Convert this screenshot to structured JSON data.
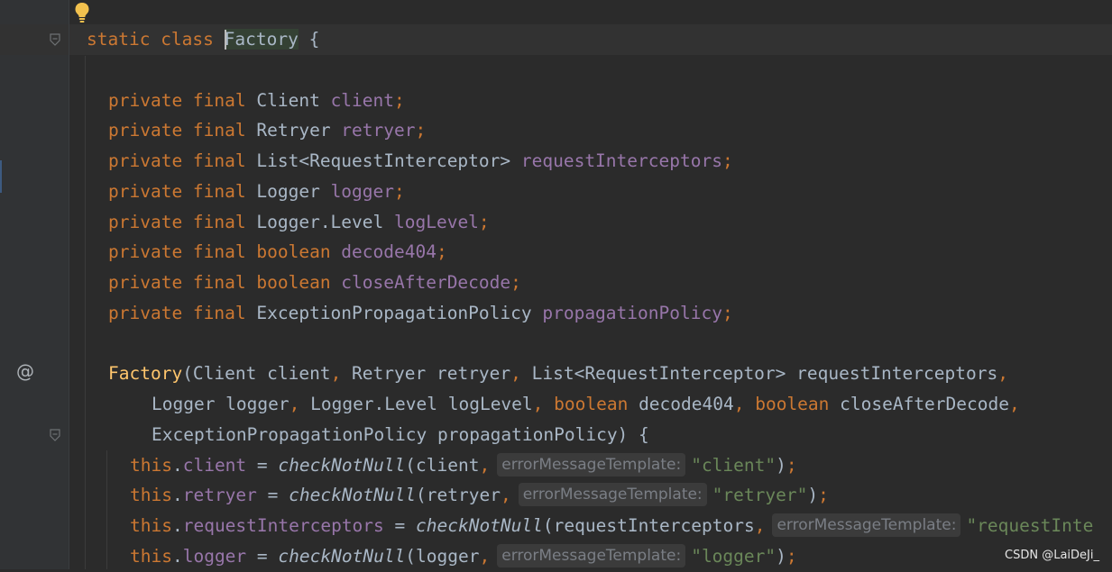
{
  "gutter": {
    "annotation_marker": "@"
  },
  "code_lines": [
    {
      "id": "class-decl",
      "tokens": [
        {
          "t": "static ",
          "c": "kw"
        },
        {
          "t": "class ",
          "c": "kw"
        },
        {
          "t": "Factory",
          "c": "plain",
          "cursor": true,
          "highlight": true
        },
        {
          "t": " {",
          "c": "plain"
        }
      ]
    },
    {
      "id": "blank-1",
      "tokens": []
    },
    {
      "id": "field-client",
      "tokens": [
        {
          "t": "private ",
          "c": "kw"
        },
        {
          "t": "final ",
          "c": "kw"
        },
        {
          "t": "Client ",
          "c": "plain"
        },
        {
          "t": "client",
          "c": "fld"
        },
        {
          "t": ";",
          "c": "kw"
        }
      ]
    },
    {
      "id": "field-retryer",
      "tokens": [
        {
          "t": "private ",
          "c": "kw"
        },
        {
          "t": "final ",
          "c": "kw"
        },
        {
          "t": "Retryer ",
          "c": "plain"
        },
        {
          "t": "retryer",
          "c": "fld"
        },
        {
          "t": ";",
          "c": "kw"
        }
      ]
    },
    {
      "id": "field-interceptors",
      "tokens": [
        {
          "t": "private ",
          "c": "kw"
        },
        {
          "t": "final ",
          "c": "kw"
        },
        {
          "t": "List<RequestInterceptor> ",
          "c": "plain"
        },
        {
          "t": "requestInterceptors",
          "c": "fld"
        },
        {
          "t": ";",
          "c": "kw"
        }
      ]
    },
    {
      "id": "field-logger",
      "tokens": [
        {
          "t": "private ",
          "c": "kw"
        },
        {
          "t": "final ",
          "c": "kw"
        },
        {
          "t": "Logger ",
          "c": "plain"
        },
        {
          "t": "logger",
          "c": "fld"
        },
        {
          "t": ";",
          "c": "kw"
        }
      ]
    },
    {
      "id": "field-loglevel",
      "tokens": [
        {
          "t": "private ",
          "c": "kw"
        },
        {
          "t": "final ",
          "c": "kw"
        },
        {
          "t": "Logger.Level ",
          "c": "plain"
        },
        {
          "t": "logLevel",
          "c": "fld"
        },
        {
          "t": ";",
          "c": "kw"
        }
      ]
    },
    {
      "id": "field-decode404",
      "tokens": [
        {
          "t": "private ",
          "c": "kw"
        },
        {
          "t": "final ",
          "c": "kw"
        },
        {
          "t": "boolean ",
          "c": "kw"
        },
        {
          "t": "decode404",
          "c": "fld"
        },
        {
          "t": ";",
          "c": "kw"
        }
      ]
    },
    {
      "id": "field-closeafterdecode",
      "tokens": [
        {
          "t": "private ",
          "c": "kw"
        },
        {
          "t": "final ",
          "c": "kw"
        },
        {
          "t": "boolean ",
          "c": "kw"
        },
        {
          "t": "closeAfterDecode",
          "c": "fld"
        },
        {
          "t": ";",
          "c": "kw"
        }
      ]
    },
    {
      "id": "field-propagationpolicy",
      "tokens": [
        {
          "t": "private ",
          "c": "kw"
        },
        {
          "t": "final ",
          "c": "kw"
        },
        {
          "t": "ExceptionPropagationPolicy ",
          "c": "plain"
        },
        {
          "t": "propagationPolicy",
          "c": "fld"
        },
        {
          "t": ";",
          "c": "kw"
        }
      ]
    },
    {
      "id": "blank-2",
      "tokens": []
    },
    {
      "id": "ctor-sig-1",
      "tokens": [
        {
          "t": "Factory",
          "c": "fn"
        },
        {
          "t": "(Client client",
          "c": "plain"
        },
        {
          "t": ", ",
          "c": "kw"
        },
        {
          "t": "Retryer retryer",
          "c": "plain"
        },
        {
          "t": ", ",
          "c": "kw"
        },
        {
          "t": "List<RequestInterceptor> requestInterceptors",
          "c": "plain"
        },
        {
          "t": ",",
          "c": "kw"
        }
      ]
    },
    {
      "id": "ctor-sig-2",
      "tokens": [
        {
          "t": "Logger logger",
          "c": "plain"
        },
        {
          "t": ", ",
          "c": "kw"
        },
        {
          "t": "Logger.Level logLevel",
          "c": "plain"
        },
        {
          "t": ", ",
          "c": "kw"
        },
        {
          "t": "boolean ",
          "c": "kw"
        },
        {
          "t": "decode404",
          "c": "plain"
        },
        {
          "t": ", ",
          "c": "kw"
        },
        {
          "t": "boolean ",
          "c": "kw"
        },
        {
          "t": "closeAfterDecode",
          "c": "plain"
        },
        {
          "t": ",",
          "c": "kw"
        }
      ]
    },
    {
      "id": "ctor-sig-3",
      "tokens": [
        {
          "t": "ExceptionPropagationPolicy propagationPolicy) {",
          "c": "plain"
        }
      ]
    },
    {
      "id": "assign-client",
      "tokens": [
        {
          "t": "this",
          "c": "kw"
        },
        {
          "t": ".",
          "c": "plain"
        },
        {
          "t": "client",
          "c": "fld"
        },
        {
          "t": " = ",
          "c": "plain"
        },
        {
          "t": "checkNotNull",
          "c": "plain",
          "italic": true
        },
        {
          "t": "(client",
          "c": "plain"
        },
        {
          "t": ",",
          "c": "kw"
        },
        {
          "hint": "errorMessageTemplate:"
        },
        {
          "t": "\"client\"",
          "c": "str"
        },
        {
          "t": ")",
          "c": "plain"
        },
        {
          "t": ";",
          "c": "kw"
        }
      ]
    },
    {
      "id": "assign-retryer",
      "tokens": [
        {
          "t": "this",
          "c": "kw"
        },
        {
          "t": ".",
          "c": "plain"
        },
        {
          "t": "retryer",
          "c": "fld"
        },
        {
          "t": " = ",
          "c": "plain"
        },
        {
          "t": "checkNotNull",
          "c": "plain",
          "italic": true
        },
        {
          "t": "(retryer",
          "c": "plain"
        },
        {
          "t": ",",
          "c": "kw"
        },
        {
          "hint": "errorMessageTemplate:"
        },
        {
          "t": "\"retryer\"",
          "c": "str"
        },
        {
          "t": ")",
          "c": "plain"
        },
        {
          "t": ";",
          "c": "kw"
        }
      ]
    },
    {
      "id": "assign-interceptors",
      "tokens": [
        {
          "t": "this",
          "c": "kw"
        },
        {
          "t": ".",
          "c": "plain"
        },
        {
          "t": "requestInterceptors",
          "c": "fld"
        },
        {
          "t": " = ",
          "c": "plain"
        },
        {
          "t": "checkNotNull",
          "c": "plain",
          "italic": true
        },
        {
          "t": "(requestInterceptors",
          "c": "plain"
        },
        {
          "t": ",",
          "c": "kw"
        },
        {
          "hint": "errorMessageTemplate:"
        },
        {
          "t": "\"requestInte",
          "c": "str"
        }
      ]
    },
    {
      "id": "assign-logger",
      "tokens": [
        {
          "t": "this",
          "c": "kw"
        },
        {
          "t": ".",
          "c": "plain"
        },
        {
          "t": "logger",
          "c": "fld"
        },
        {
          "t": " = ",
          "c": "plain"
        },
        {
          "t": "checkNotNull",
          "c": "plain",
          "italic": true
        },
        {
          "t": "(logger",
          "c": "plain"
        },
        {
          "t": ",",
          "c": "kw"
        },
        {
          "hint": "errorMessageTemplate:"
        },
        {
          "t": "\"logger\"",
          "c": "str"
        },
        {
          "t": ")",
          "c": "plain"
        },
        {
          "t": ";",
          "c": "kw"
        }
      ]
    }
  ],
  "watermark": "CSDN @LaiDeJi_",
  "colors": {
    "background": "#2b2b2b",
    "keyword": "#cc7832",
    "field": "#9876aa",
    "method_decl": "#ffc66d",
    "string": "#6a8759",
    "plain": "#a9b7c6"
  },
  "icons": {
    "intention_bulb": "lightbulb-icon",
    "fold_markers": "fold-icon"
  }
}
